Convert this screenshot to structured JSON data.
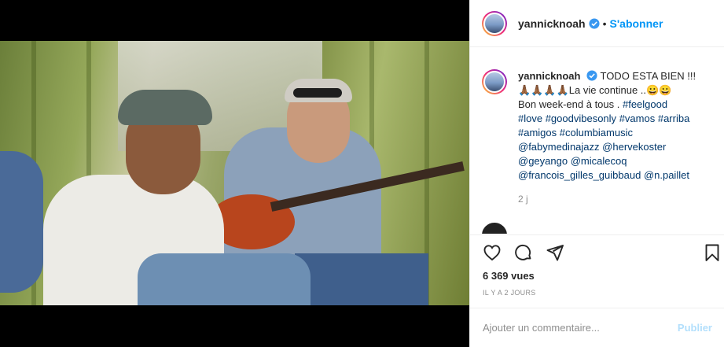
{
  "post": {
    "username": "yannicknoah",
    "follow_label": "S'abonner",
    "separator": "•",
    "caption_title": "TODO ESTA BIEN !!!",
    "caption_line2": "🙏🏾🙏🏾🙏🏾🙏🏾La vie continue ..😀😀",
    "caption_line3": "Bon week-end à tous .",
    "hashtags": [
      "#feelgood",
      "#love",
      "#goodvibesonly",
      "#vamos",
      "#arriba",
      "#amigos",
      "#columbiamusic"
    ],
    "mentions": [
      "@fabymedinajazz",
      "@hervekoster",
      "@geyango",
      "@micalecoq",
      "@francois_gilles_guibbaud",
      "@n.paillet"
    ],
    "caption_age": "2 j",
    "views": "6 369 vues",
    "posted_ago": "IL Y A 2 JOURS"
  },
  "comment": {
    "placeholder": "Ajouter un commentaire...",
    "post_label": "Publier"
  },
  "icons": {
    "like": "heart-icon",
    "comment": "comment-icon",
    "share": "paper-plane-icon",
    "save": "bookmark-icon",
    "verified": "verified-badge-icon"
  },
  "colors": {
    "link": "#0095f6",
    "hashtag": "#00376b",
    "muted": "#8e8e8e",
    "post_disabled": "#b2dffc"
  }
}
